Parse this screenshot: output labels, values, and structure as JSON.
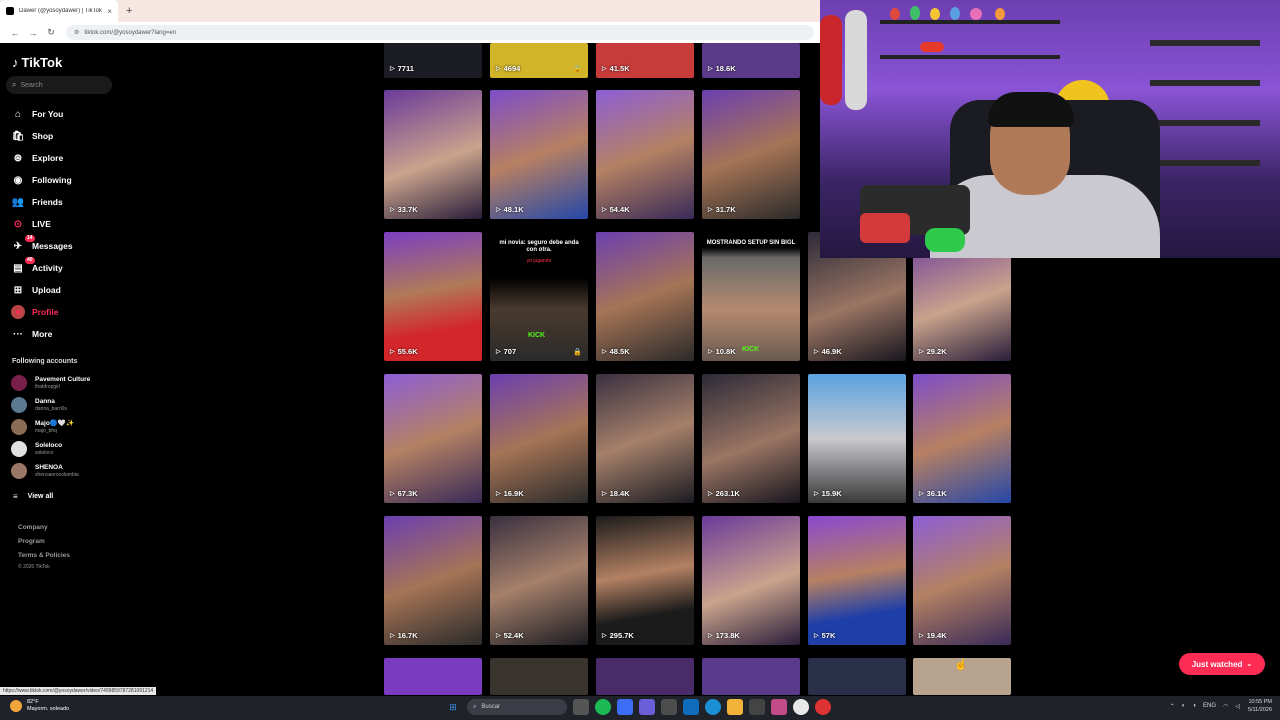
{
  "browser": {
    "tab_title": "Dawer (@yosoydawer) | TikTok",
    "url": "tiktok.com/@yosoydawer?lang=en",
    "new_tab": "+",
    "close": "×",
    "back": "←",
    "forward": "→",
    "reload": "↻"
  },
  "sidebar": {
    "logo": "TikTok",
    "search_placeholder": "Search",
    "nav": [
      {
        "label": "For You",
        "icon": "⌂"
      },
      {
        "label": "Shop",
        "icon": "🛍"
      },
      {
        "label": "Explore",
        "icon": "⊛"
      },
      {
        "label": "Following",
        "icon": "◉"
      },
      {
        "label": "Friends",
        "icon": "👥"
      },
      {
        "label": "LIVE",
        "icon": "⊙"
      },
      {
        "label": "Messages",
        "icon": "✈",
        "badge": "14"
      },
      {
        "label": "Activity",
        "icon": "▤",
        "badge": "40"
      },
      {
        "label": "Upload",
        "icon": "⊞"
      },
      {
        "label": "Profile",
        "icon": "●"
      },
      {
        "label": "More",
        "icon": "···"
      }
    ],
    "following_title": "Following accounts",
    "accounts": [
      {
        "name": "Pavement Culture",
        "handle": "thatdropgirl",
        "color": "#7a1f4a"
      },
      {
        "name": "Danna",
        "handle": "danna_barri0s",
        "color": "#5b7a90"
      },
      {
        "name": "Majo🔵🤍✨",
        "handle": "majo_bhq",
        "color": "#8a6b55"
      },
      {
        "name": "Soleloco",
        "handle": "soleloco",
        "color": "#e0e0e0"
      },
      {
        "name": "SHENOA",
        "handle": "shenoaorocolombia",
        "color": "#9a7766"
      }
    ],
    "view_all": "View all",
    "footer": [
      "Company",
      "Program",
      "Terms & Policies"
    ],
    "copyright": "© 2026 TikTok"
  },
  "grid": {
    "top_row": [
      {
        "views": "7711",
        "locked": false
      },
      {
        "views": "4694",
        "locked": true
      },
      {
        "views": "41.5K",
        "locked": false
      },
      {
        "views": "18.6K",
        "locked": false
      }
    ],
    "rows": [
      [
        {
          "views": "33.7K"
        },
        {
          "views": "48.1K"
        },
        {
          "views": "54.4K"
        },
        {
          "views": "31.7K"
        }
      ],
      [
        {
          "views": "55.6K"
        },
        {
          "views": "707",
          "locked": true,
          "caption": "mi novia: seguro debe anda con otra.",
          "caption2": "yo jugando",
          "kick": "KICK"
        },
        {
          "views": "48.5K"
        },
        {
          "views": "10.8K",
          "caption": "MOSTRANDO SETUP SIN BIGL",
          "kick": "KICK"
        },
        {
          "views": "46.9K"
        },
        {
          "views": "29.2K"
        }
      ],
      [
        {
          "views": "67.3K"
        },
        {
          "views": "16.9K"
        },
        {
          "views": "18.4K"
        },
        {
          "views": "263.1K"
        },
        {
          "views": "15.9K"
        },
        {
          "views": "36.1K"
        }
      ],
      [
        {
          "views": "16.7K"
        },
        {
          "views": "52.4K"
        },
        {
          "views": "295.7K"
        },
        {
          "views": "173.8K"
        },
        {
          "views": "57K"
        },
        {
          "views": "19.4K"
        }
      ]
    ]
  },
  "just_watched": "Just watched",
  "status_url": "https://www.tiktok.com/@yosoydawer/video/7499859787281091214",
  "taskbar": {
    "temp": "82°F",
    "weather": "Mayorm. soleado",
    "search": "Buscar",
    "lang": "ENG",
    "time": "10:55 PM",
    "date": "5/11/2026"
  }
}
